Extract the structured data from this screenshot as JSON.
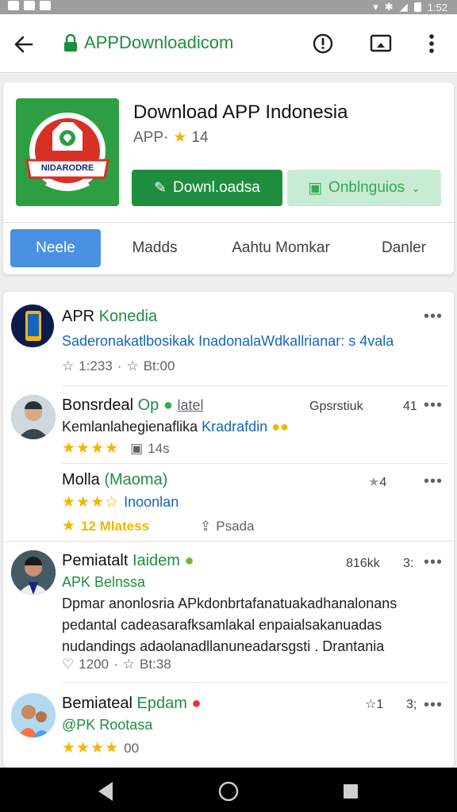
{
  "status": {
    "time": "1:52"
  },
  "browser": {
    "url": "APPDownloadicom"
  },
  "app": {
    "title": "Download APP Indonesia",
    "meta_prefix": "APP·",
    "meta_rating": "14",
    "icon_label": "NIDARODRE",
    "download_label": "Downl.oadsa",
    "options_label": "Onblnguios"
  },
  "tabs": [
    "Neele",
    "Madds",
    "Aahtu Momkar",
    "Danler"
  ],
  "posts": [
    {
      "name": "APR",
      "name_highlight": "Konedia",
      "subtitle": "Saderonakatlbosikak InadonalaWdkallrianar: s 4vala",
      "stats_likes": "1:233",
      "stats_reposts": "Bt:00"
    },
    {
      "name": "Bonsrdeal",
      "name_highlight": "Op",
      "name_tag": "latel",
      "right_meta": "Gpsrstiuk",
      "right_count": "41",
      "body": "Kemlanlahegienaflika",
      "body_highlight": "Kradrafdin",
      "stats_stars": "★★★★",
      "stats_time": "14s"
    },
    {
      "name": "Molla",
      "name_highlight": "(Maoma)",
      "right_count": "4",
      "subtitle": "Inoonlan",
      "stats_stars": "★★★☆",
      "promo": "12 Mlatess",
      "stats_time": "Psada"
    },
    {
      "name": "Pemiatalt",
      "name_highlight": "Iaidem",
      "right_meta": "816kk",
      "right_count": "3:",
      "subtitle": "APK Belnssa",
      "body": "Dpmar anonlosria APkdonbrtafanatuakadhanalonans pedantal cadeasarafksamlakal enpaialsakanuadas nudandings adaolanadllanuneadarsgsti . Drantania",
      "stats_likes": "1200",
      "stats_reposts": "Bt:38"
    },
    {
      "name": "Bemiateal",
      "name_highlight": "Epdam",
      "right_count": "1",
      "right_extra": "3;",
      "subtitle": "@PK Rootasa",
      "stats_stars": "★★★★",
      "stats_time": "00"
    }
  ]
}
